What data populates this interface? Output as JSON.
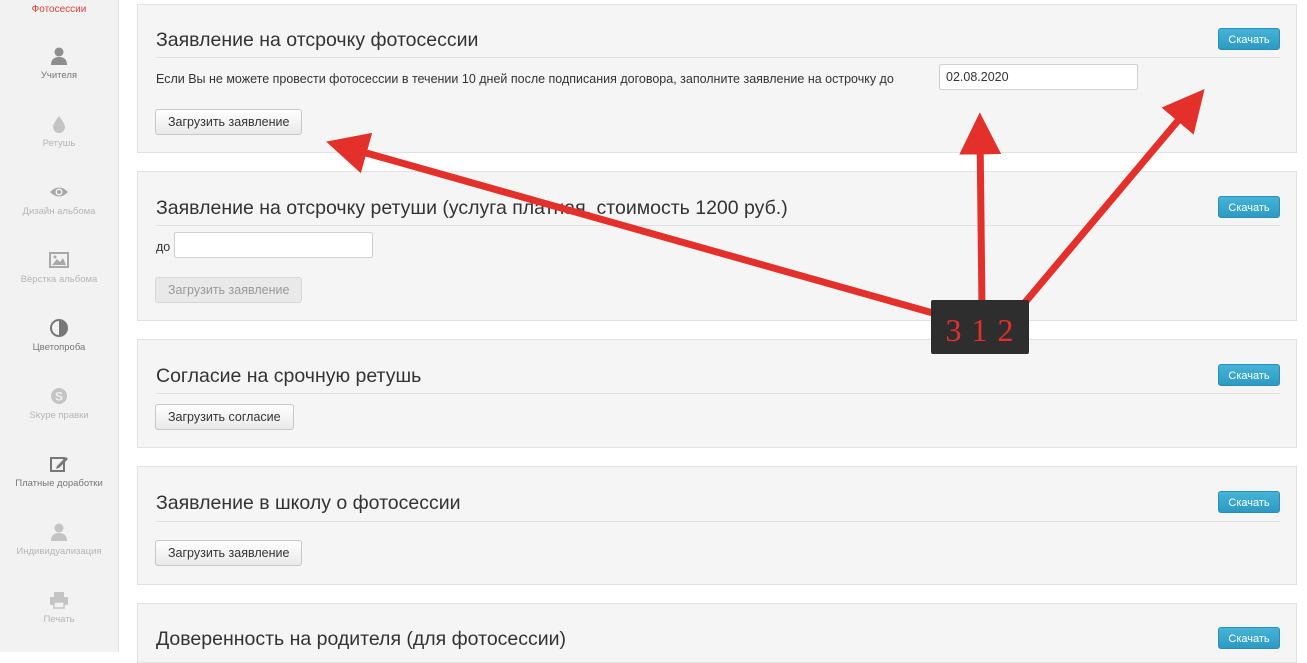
{
  "sidebar": {
    "active_label": "Фотосессии",
    "items": [
      {
        "label": "Учителя",
        "icon": "user-icon"
      },
      {
        "label": "Ретушь",
        "icon": "drop-icon"
      },
      {
        "label": "Дизайн альбома",
        "icon": "eye-icon"
      },
      {
        "label": "Вёрстка альбома",
        "icon": "image-icon"
      },
      {
        "label": "Цветопроба",
        "icon": "contrast-icon"
      },
      {
        "label": "Skype правки",
        "icon": "skype-icon"
      },
      {
        "label": "Платные доработки",
        "icon": "edit-icon"
      },
      {
        "label": "Индивидуализация",
        "icon": "user-icon"
      },
      {
        "label": "Печать",
        "icon": "print-icon"
      }
    ]
  },
  "panels": [
    {
      "title": "Заявление на отсрочку фотосессии",
      "download_label": "Скачать",
      "description": "Если Вы не можете провести фотосессии в течении 10 дней после подписания договора, заполните заявление на острочку до",
      "date_value": "02.08.2020",
      "upload_label": "Загрузить заявление"
    },
    {
      "title": "Заявление на отсрочку ретуши (услуга платная, стоимость 1200 руб.)",
      "download_label": "Скачать",
      "field_label": "до",
      "date_value": "",
      "upload_label": "Загрузить заявление"
    },
    {
      "title": "Согласие на срочную ретушь",
      "download_label": "Скачать",
      "upload_label": "Загрузить согласие"
    },
    {
      "title": "Заявление в школу о фотосессии",
      "download_label": "Скачать",
      "upload_label": "Загрузить заявление"
    },
    {
      "title": "Доверенность на родителя (для фотосессии)",
      "download_label": "Скачать"
    }
  ],
  "annotation": {
    "label": "3 1 2",
    "color": "#e4302b"
  }
}
